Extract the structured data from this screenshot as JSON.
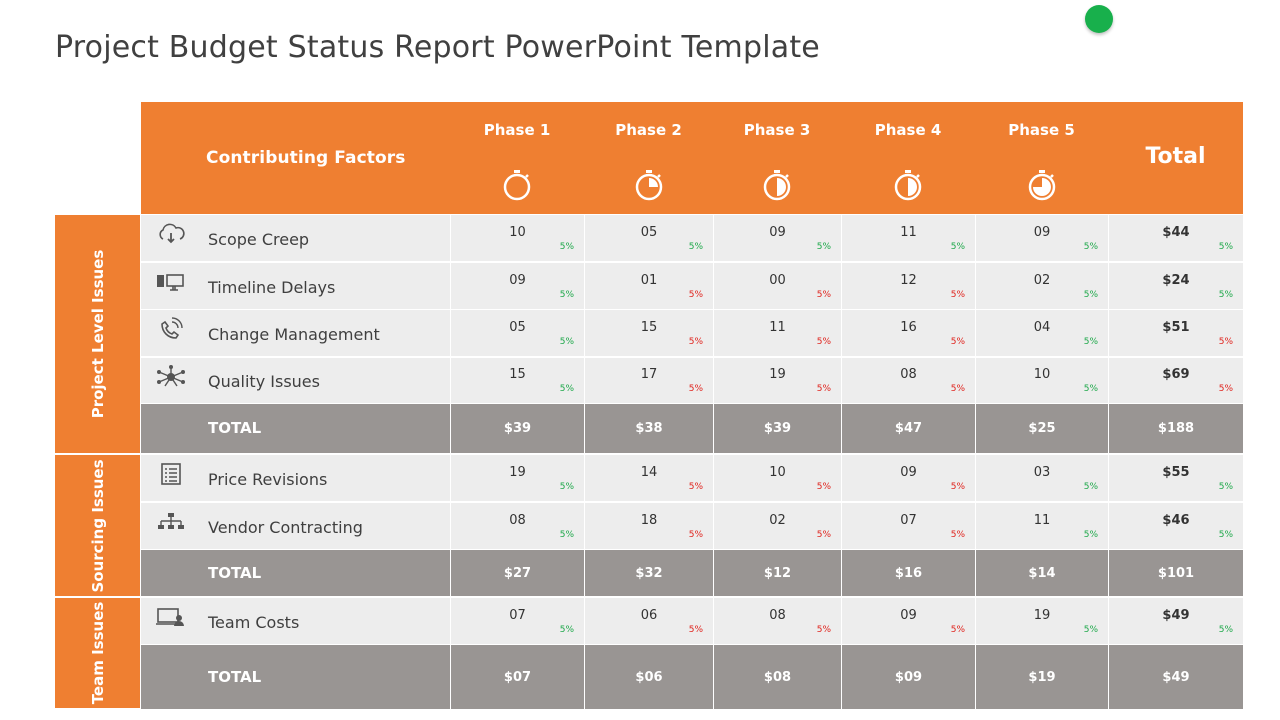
{
  "title": "Project Budget Status Report PowerPoint Template",
  "colors": {
    "accent": "#ef7f31",
    "total_row": "#999593",
    "data_row": "#ededed",
    "positive": "#1ea84a",
    "negative": "#e0231d",
    "dot": "#18b04c"
  },
  "header": {
    "factor_label": "Contributing  Factors",
    "phases": [
      {
        "label": "Phase 1",
        "icon": "stopwatch-empty-icon"
      },
      {
        "label": "Phase 2",
        "icon": "stopwatch-quarter-icon"
      },
      {
        "label": "Phase 3",
        "icon": "stopwatch-half-icon"
      },
      {
        "label": "Phase 4",
        "icon": "stopwatch-half-left-icon"
      },
      {
        "label": "Phase 5",
        "icon": "stopwatch-three-quarter-icon"
      }
    ],
    "total_label": "Total"
  },
  "groups": [
    {
      "label": "Project Level Issues",
      "rows": [
        {
          "label": "Scope Creep",
          "icon": "cloud-download-icon",
          "values": [
            "10",
            "05",
            "09",
            "11",
            "09"
          ],
          "pcts": [
            [
              "5%",
              "green"
            ],
            [
              "5%",
              "green"
            ],
            [
              "5%",
              "green"
            ],
            [
              "5%",
              "green"
            ],
            [
              "5%",
              "green"
            ]
          ],
          "total": "$44",
          "total_pct": [
            "5%",
            "green"
          ]
        },
        {
          "label": "Timeline Delays",
          "icon": "computer-monitor-icon",
          "values": [
            "09",
            "01",
            "00",
            "12",
            "02"
          ],
          "pcts": [
            [
              "5%",
              "green"
            ],
            [
              "5%",
              "red"
            ],
            [
              "5%",
              "red"
            ],
            [
              "5%",
              "red"
            ],
            [
              "5%",
              "green"
            ]
          ],
          "total": "$24",
          "total_pct": [
            "5%",
            "green"
          ]
        },
        {
          "label": "Change Management",
          "icon": "phone-ringing-icon",
          "values": [
            "05",
            "15",
            "11",
            "16",
            "04"
          ],
          "pcts": [
            [
              "5%",
              "green"
            ],
            [
              "5%",
              "red"
            ],
            [
              "5%",
              "red"
            ],
            [
              "5%",
              "red"
            ],
            [
              "5%",
              "green"
            ]
          ],
          "total": "$51",
          "total_pct": [
            "5%",
            "red"
          ]
        },
        {
          "label": "Quality Issues",
          "icon": "network-hub-icon",
          "values": [
            "15",
            "17",
            "19",
            "08",
            "10"
          ],
          "pcts": [
            [
              "5%",
              "green"
            ],
            [
              "5%",
              "red"
            ],
            [
              "5%",
              "red"
            ],
            [
              "5%",
              "red"
            ],
            [
              "5%",
              "green"
            ]
          ],
          "total": "$69",
          "total_pct": [
            "5%",
            "red"
          ]
        }
      ],
      "total": {
        "label": "TOTAL",
        "values": [
          "$39",
          "$38",
          "$39",
          "$47",
          "$25"
        ],
        "grand": "$188"
      }
    },
    {
      "label": "Sourcing Issues",
      "rows": [
        {
          "label": "Price Revisions",
          "icon": "document-list-icon",
          "values": [
            "19",
            "14",
            "10",
            "09",
            "03"
          ],
          "pcts": [
            [
              "5%",
              "green"
            ],
            [
              "5%",
              "red"
            ],
            [
              "5%",
              "red"
            ],
            [
              "5%",
              "red"
            ],
            [
              "5%",
              "green"
            ]
          ],
          "total": "$55",
          "total_pct": [
            "5%",
            "green"
          ]
        },
        {
          "label": "Vendor Contracting",
          "icon": "org-chart-icon",
          "values": [
            "08",
            "18",
            "02",
            "07",
            "11"
          ],
          "pcts": [
            [
              "5%",
              "green"
            ],
            [
              "5%",
              "red"
            ],
            [
              "5%",
              "red"
            ],
            [
              "5%",
              "red"
            ],
            [
              "5%",
              "green"
            ]
          ],
          "total": "$46",
          "total_pct": [
            "5%",
            "green"
          ]
        }
      ],
      "total": {
        "label": "TOTAL",
        "values": [
          "$27",
          "$32",
          "$12",
          "$16",
          "$14"
        ],
        "grand": "$101"
      }
    },
    {
      "label": "Team  Issues",
      "rows": [
        {
          "label": "Team Costs",
          "icon": "laptop-user-icon",
          "values": [
            "07",
            "06",
            "08",
            "09",
            "19"
          ],
          "pcts": [
            [
              "5%",
              "green"
            ],
            [
              "5%",
              "red"
            ],
            [
              "5%",
              "red"
            ],
            [
              "5%",
              "red"
            ],
            [
              "5%",
              "green"
            ]
          ],
          "total": "$49",
          "total_pct": [
            "5%",
            "green"
          ]
        }
      ],
      "total": {
        "label": "TOTAL",
        "values": [
          "$07",
          "$06",
          "$08",
          "$09",
          "$19"
        ],
        "grand": "$49"
      }
    }
  ]
}
